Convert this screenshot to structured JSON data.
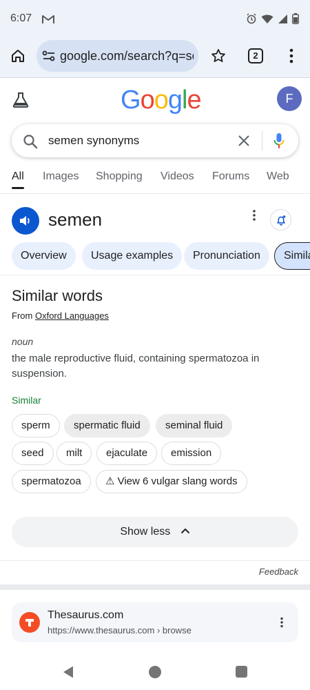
{
  "status_bar": {
    "time": "6:07",
    "notification_icon": "gmail-icon",
    "icons": [
      "alarm-icon",
      "wifi-icon",
      "signal-icon",
      "battery-icon"
    ]
  },
  "browser": {
    "url": "google.com/search?q=semen+synonyms",
    "tab_count": "2"
  },
  "google": {
    "avatar_letter": "F",
    "logo": {
      "letters": [
        "G",
        "o",
        "o",
        "g",
        "l",
        "e"
      ],
      "colors": [
        "#4285F4",
        "#EA4335",
        "#FBBC05",
        "#4285F4",
        "#34A853",
        "#EA4335"
      ]
    },
    "search_query": "semen synonyms",
    "tabs": [
      "All",
      "Images",
      "Shopping",
      "Videos",
      "Forums",
      "Web"
    ],
    "active_tab": "All"
  },
  "dictionary": {
    "word": "semen",
    "chips": [
      "Overview",
      "Usage examples",
      "Pronunciation",
      "Similar"
    ],
    "selected_chip": "Similar",
    "section_title": "Similar words",
    "source_prefix": "From",
    "source_name": "Oxford Languages",
    "part_of_speech": "noun",
    "definition": "the male reproductive fluid, containing spermatozoa in suspension.",
    "similar_label": "Similar",
    "synonyms": [
      "sperm",
      "spermatic fluid",
      "seminal fluid",
      "seed",
      "milt",
      "ejaculate",
      "emission",
      "spermatozoa"
    ],
    "vulgar_button": "⚠ View 6 vulgar slang words",
    "show_less": "Show less",
    "feedback": "Feedback"
  },
  "result": {
    "site_name": "Thesaurus.com",
    "url": "https://www.thesaurus.com › browse",
    "favicon_color": "#F44D25"
  },
  "colors": {
    "accent_blue": "#0B57D0",
    "chip_bg": "#E8F0FE",
    "similar_green": "#188038"
  }
}
